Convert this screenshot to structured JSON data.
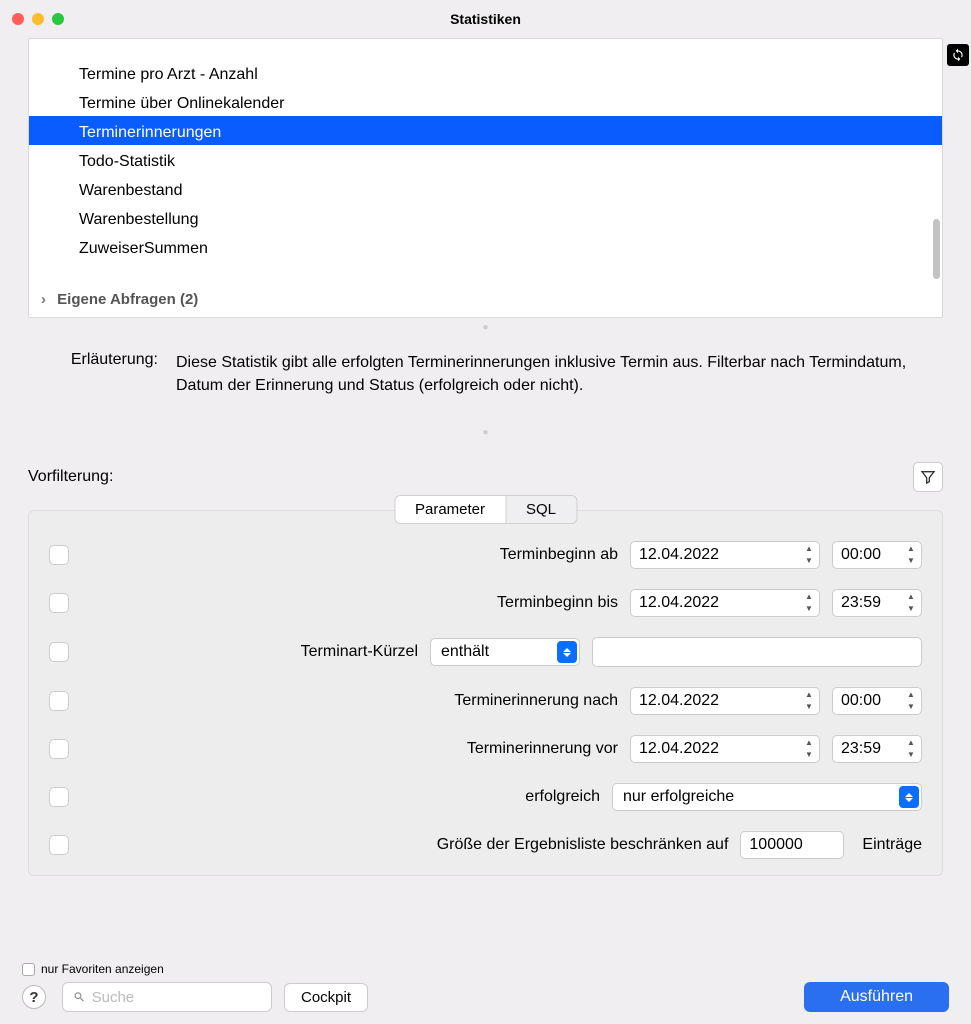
{
  "window": {
    "title": "Statistiken"
  },
  "list": {
    "partial": "",
    "items": [
      "Termine pro Arzt - Anzahl",
      "Termine über Onlinekalender",
      "Terminerinnerungen",
      "Todo-Statistik",
      "Warenbestand",
      "Warenbestellung",
      "ZuweiserSummen"
    ],
    "selected_index": 2,
    "group": "Eigene Abfragen (2)"
  },
  "description": {
    "label": "Erläuterung:",
    "text": "Diese Statistik gibt alle erfolgten Terminerinnerungen inklusive Termin aus. Filterbar nach Termindatum, Datum der Erinnerung und Status (erfolgreich oder nicht)."
  },
  "prefilter": {
    "label": "Vorfilterung:"
  },
  "tabs": {
    "parameter": "Parameter",
    "sql": "SQL"
  },
  "params": {
    "terminbeginn_ab": {
      "label": "Terminbeginn ab",
      "date": "12.04.2022",
      "time": "00:00"
    },
    "terminbeginn_bis": {
      "label": "Terminbeginn bis",
      "date": "12.04.2022",
      "time": "23:59"
    },
    "terminart_kuerzel": {
      "label": "Terminart-Kürzel",
      "operator": "enthält",
      "value": ""
    },
    "erinnerung_nach": {
      "label": "Terminerinnerung nach",
      "date": "12.04.2022",
      "time": "00:00"
    },
    "erinnerung_vor": {
      "label": "Terminerinnerung vor",
      "date": "12.04.2022",
      "time": "23:59"
    },
    "erfolgreich": {
      "label": "erfolgreich",
      "value": "nur erfolgreiche"
    },
    "limit": {
      "label": "Größe der Ergebnisliste beschränken auf",
      "value": "100000",
      "suffix": "Einträge"
    }
  },
  "bottom": {
    "favorites_label": "nur Favoriten anzeigen",
    "search_placeholder": "Suche",
    "cockpit": "Cockpit",
    "run": "Ausführen"
  }
}
